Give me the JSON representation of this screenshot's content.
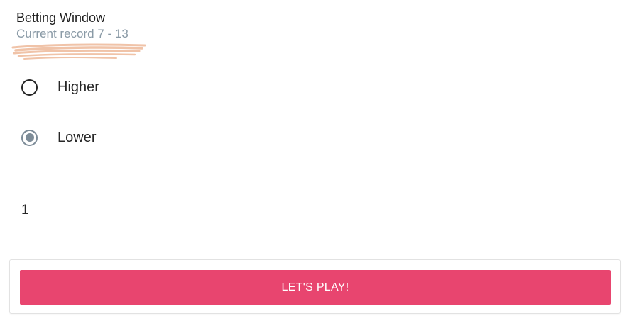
{
  "header": {
    "title": "Betting Window",
    "record": "Current record 7 - 13"
  },
  "bet_options": [
    {
      "label": "Higher",
      "checked": false
    },
    {
      "label": "Lower",
      "checked": true
    }
  ],
  "amount": {
    "value": "1"
  },
  "play_button": {
    "label": "LET'S PLAY!"
  },
  "colors": {
    "accent": "#e8456f",
    "scribble": "#f0c3a8",
    "subtitle": "#8a9aa6",
    "radio_checked": "#7d8c98"
  }
}
